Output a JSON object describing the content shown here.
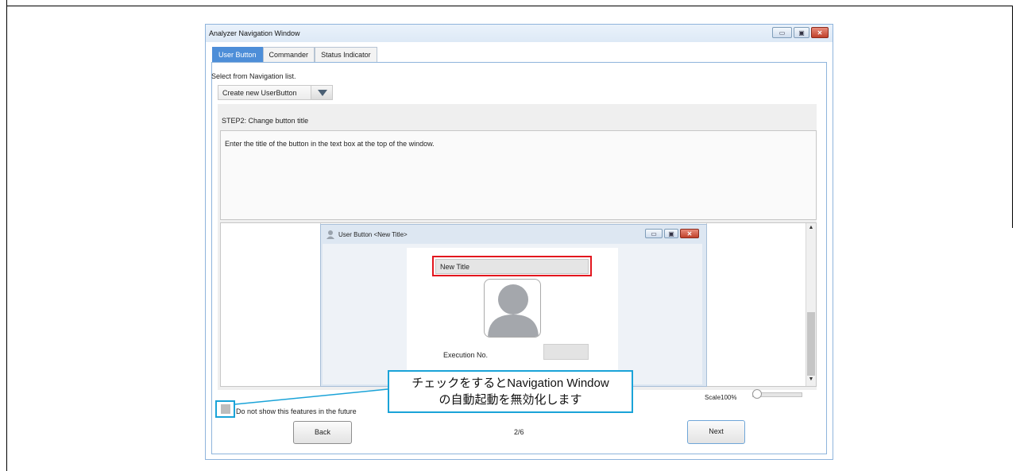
{
  "window": {
    "title": "Analyzer Navigation Window",
    "controls": {
      "minimize": "▭",
      "restore": "▣",
      "close": "✕"
    }
  },
  "tabs": [
    {
      "label": "User Button",
      "active": true
    },
    {
      "label": "Commander",
      "active": false
    },
    {
      "label": "Status Indicator",
      "active": false
    }
  ],
  "navigation": {
    "select_label": "Select from Navigation list.",
    "dropdown_value": "Create new UserButton"
  },
  "step": {
    "title": "STEP2: Change button title",
    "description": "Enter the title of the button in the text box at the top of the window."
  },
  "preview": {
    "window_title": "User Button <New Title>",
    "title_input_value": "New Title",
    "execution_label": "Execution No.",
    "highlight_color": "#e2161e"
  },
  "zoom": {
    "label": "Scale100%"
  },
  "callout": {
    "line1": "チェックをするとNavigation Window",
    "line2": "の自動起動を無効化します",
    "border_color": "#1aa3d8"
  },
  "footer": {
    "checkbox_label": "Do not show this features in the future",
    "back_label": "Back",
    "page_indicator": "2/6",
    "next_label": "Next"
  },
  "colors": {
    "accent": "#4d8ed8",
    "window_border": "#8fb4dc"
  }
}
